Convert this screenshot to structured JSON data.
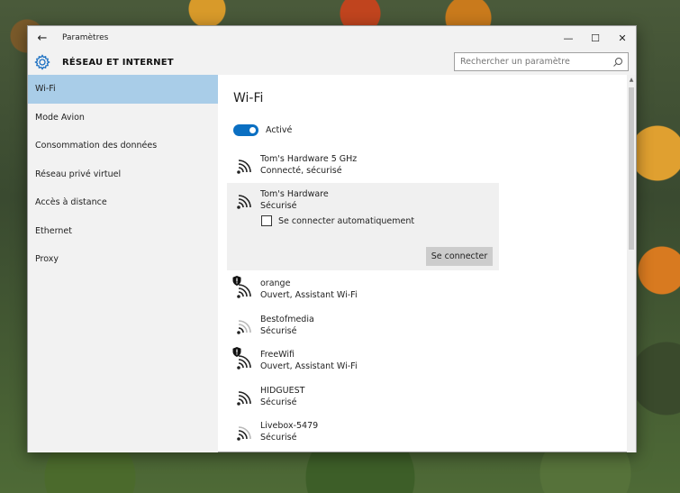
{
  "window": {
    "title": "Paramètres",
    "back_glyph": "←",
    "controls": {
      "minimize": "—",
      "maximize": "☐",
      "close": "✕"
    }
  },
  "header": {
    "app_name": "RÉSEAU ET INTERNET",
    "search_placeholder": "Rechercher un paramètre"
  },
  "sidebar": {
    "items": [
      {
        "label": "Wi-Fi",
        "active": true
      },
      {
        "label": "Mode Avion"
      },
      {
        "label": "Consommation des données"
      },
      {
        "label": "Réseau privé virtuel"
      },
      {
        "label": "Accès à distance"
      },
      {
        "label": "Ethernet"
      },
      {
        "label": "Proxy"
      }
    ]
  },
  "main": {
    "title": "Wi-Fi",
    "toggle_label": "Activé",
    "networks": [
      {
        "name": "Tom's Hardware 5 GHz",
        "status": "Connecté, sécurisé",
        "shield": false,
        "strength": 4
      },
      {
        "name": "Tom's Hardware",
        "status": "Sécurisé",
        "shield": false,
        "strength": 4
      },
      {
        "name": "orange",
        "status": "Ouvert, Assistant Wi-Fi",
        "shield": true,
        "strength": 4
      },
      {
        "name": "Bestofmedia",
        "status": "Sécurisé",
        "shield": false,
        "strength": 2
      },
      {
        "name": "FreeWifi",
        "status": "Ouvert, Assistant Wi-Fi",
        "shield": true,
        "strength": 4
      },
      {
        "name": "HIDGUEST",
        "status": "Sécurisé",
        "shield": false,
        "strength": 4
      },
      {
        "name": "Livebox-5479",
        "status": "Sécurisé",
        "shield": false,
        "strength": 3
      }
    ],
    "selected": {
      "auto_connect_label": "Se connecter automatiquement",
      "auto_connect_checked": false,
      "connect_button": "Se connecter"
    }
  },
  "colors": {
    "accent": "#0a6fc2",
    "selected_nav": "#a9cde8",
    "sidebar_bg": "#f2f2f2"
  }
}
